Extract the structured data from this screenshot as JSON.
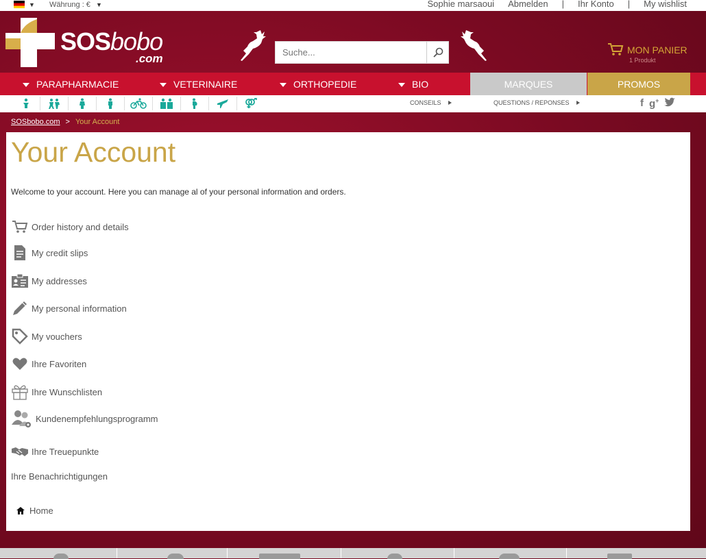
{
  "topbar": {
    "currency": "Währung : €",
    "user_name": "Sophie marsaoui",
    "logout": "Abmelden",
    "account": "Ihr Konto",
    "wishlist": "My wishlist",
    "separator": "|"
  },
  "header": {
    "brand_sos": "SOS",
    "brand_bobo": "bobo",
    "brand_com": ".com",
    "search_placeholder": "Suche...",
    "cart_label": "MON PANIER",
    "cart_count": "1 Produkt"
  },
  "mainnav": {
    "items": [
      {
        "label": "PARAPHARMACIE"
      },
      {
        "label": "VETERINAIRE"
      },
      {
        "label": "ORTHOPEDIE"
      },
      {
        "label": "BIO"
      }
    ],
    "marques": "MARQUES",
    "promos": "PROMOS",
    "colors": {
      "nav_red": "#c8112e",
      "marques_gray": "#c9c9c9",
      "promos_gold": "#c9a548",
      "icon_teal": "#1aa99a"
    }
  },
  "subnav": {
    "icons": [
      "baby-icon",
      "kids-icon",
      "woman-icon",
      "man-icon",
      "bike-icon",
      "family-icon",
      "pregnant-icon",
      "travel-icon",
      "gender-icon"
    ],
    "conseils": "CONSEILS",
    "questions": "QUESTIONS / REPONSES"
  },
  "breadcrumb": {
    "home": "SOSbobo.com",
    "separator": ">",
    "current": "Your Account"
  },
  "account": {
    "title": "Your Account",
    "welcome": "Welcome to your account. Here you can manage al of your personal information and orders.",
    "items": [
      {
        "label": "Order history and details",
        "icon": "cart-icon"
      },
      {
        "label": "My credit slips",
        "icon": "document-icon"
      },
      {
        "label": "My addresses",
        "icon": "id-card-icon"
      },
      {
        "label": "My personal information",
        "icon": "pencil-icon"
      },
      {
        "label": "My vouchers",
        "icon": "tag-icon"
      },
      {
        "label": "Ihre Favoriten",
        "icon": "heart-icon"
      },
      {
        "label": "Ihre Wunschlisten",
        "icon": "gift-icon"
      },
      {
        "label": "Kundenempfehlungsprogramm",
        "icon": "referral-icon"
      },
      {
        "label": "Ihre Treuepunkte",
        "icon": "handshake-icon"
      }
    ],
    "notifications": "Ihre Benachrichtigungen",
    "home": "Home"
  }
}
